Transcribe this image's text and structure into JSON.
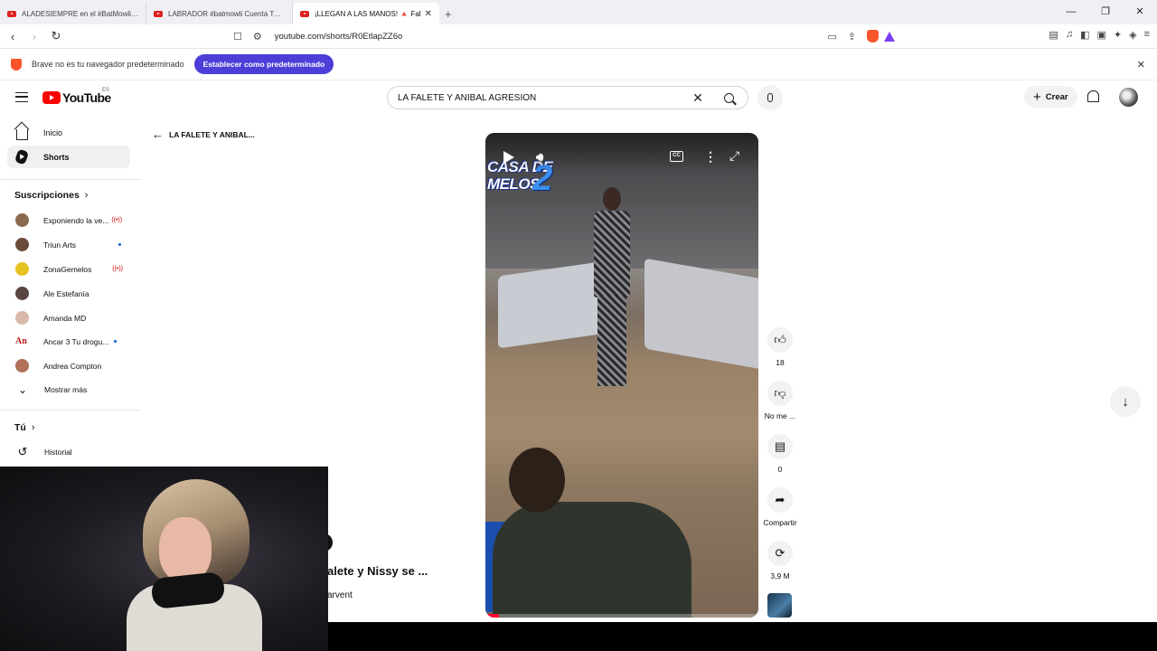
{
  "browser": {
    "tabs": [
      {
        "title": "ALADESIEMPRE en el #BatMowli ¿Qu",
        "active": false
      },
      {
        "title": "LABRADOR #batmowli Cuenta TODA",
        "active": false
      },
      {
        "title": "¡LLEGAN A LAS MANOS! 🔺 Fal",
        "active": true
      }
    ],
    "url": "youtube.com/shorts/R0EtlapZZ6o",
    "default_prompt": {
      "message": "Brave no es tu navegador predeterminado",
      "button": "Establecer como predeterminado"
    }
  },
  "header": {
    "logo": "YouTube",
    "country_code": "ES",
    "search_value": "LA FALETE Y ANIBAL AGRESION",
    "create_label": "Crear"
  },
  "sidebar": {
    "items": [
      {
        "label": "Inicio",
        "icon": "home-icon"
      },
      {
        "label": "Shorts",
        "icon": "shorts-icon",
        "active": true
      }
    ],
    "subscriptions_title": "Suscripciones",
    "subscriptions": [
      {
        "name": "Exponiendo la ve...",
        "status": "live",
        "color": "#8a6a4e"
      },
      {
        "name": "Triun Arts",
        "status": "new",
        "color": "#6b4a3a"
      },
      {
        "name": "ZonaGemelos",
        "status": "live",
        "color": "#e6c220"
      },
      {
        "name": "Ale Estefanía",
        "status": "none",
        "color": "#5a4540"
      },
      {
        "name": "Amanda MD",
        "status": "none",
        "color": "#d8b8a8"
      },
      {
        "name": "Ancar 3 Tu drogu...",
        "status": "new",
        "color": "#c21818",
        "avatar_text": "An"
      },
      {
        "name": "Andrea Compton",
        "status": "none",
        "color": "#b0705a"
      }
    ],
    "show_more": "Mostrar más",
    "you_title": "Tú",
    "history": "Historial"
  },
  "main": {
    "back_label": "LA FALETE Y ANIBAL...",
    "video": {
      "overlay_text": "CASA DE\nMELOS",
      "overlay_number": "2",
      "progress": 0.05
    },
    "actions": [
      {
        "icon": "like-icon",
        "label": "18"
      },
      {
        "icon": "dislike-icon",
        "label": "No me ..."
      },
      {
        "icon": "comment-icon",
        "label": "0"
      },
      {
        "icon": "share-icon",
        "label": "Compartir"
      },
      {
        "icon": "remix-icon",
        "label": "3,9 M"
      }
    ],
    "title_peek": "alete y Nissy se ...",
    "channel_peek": "arvent"
  }
}
